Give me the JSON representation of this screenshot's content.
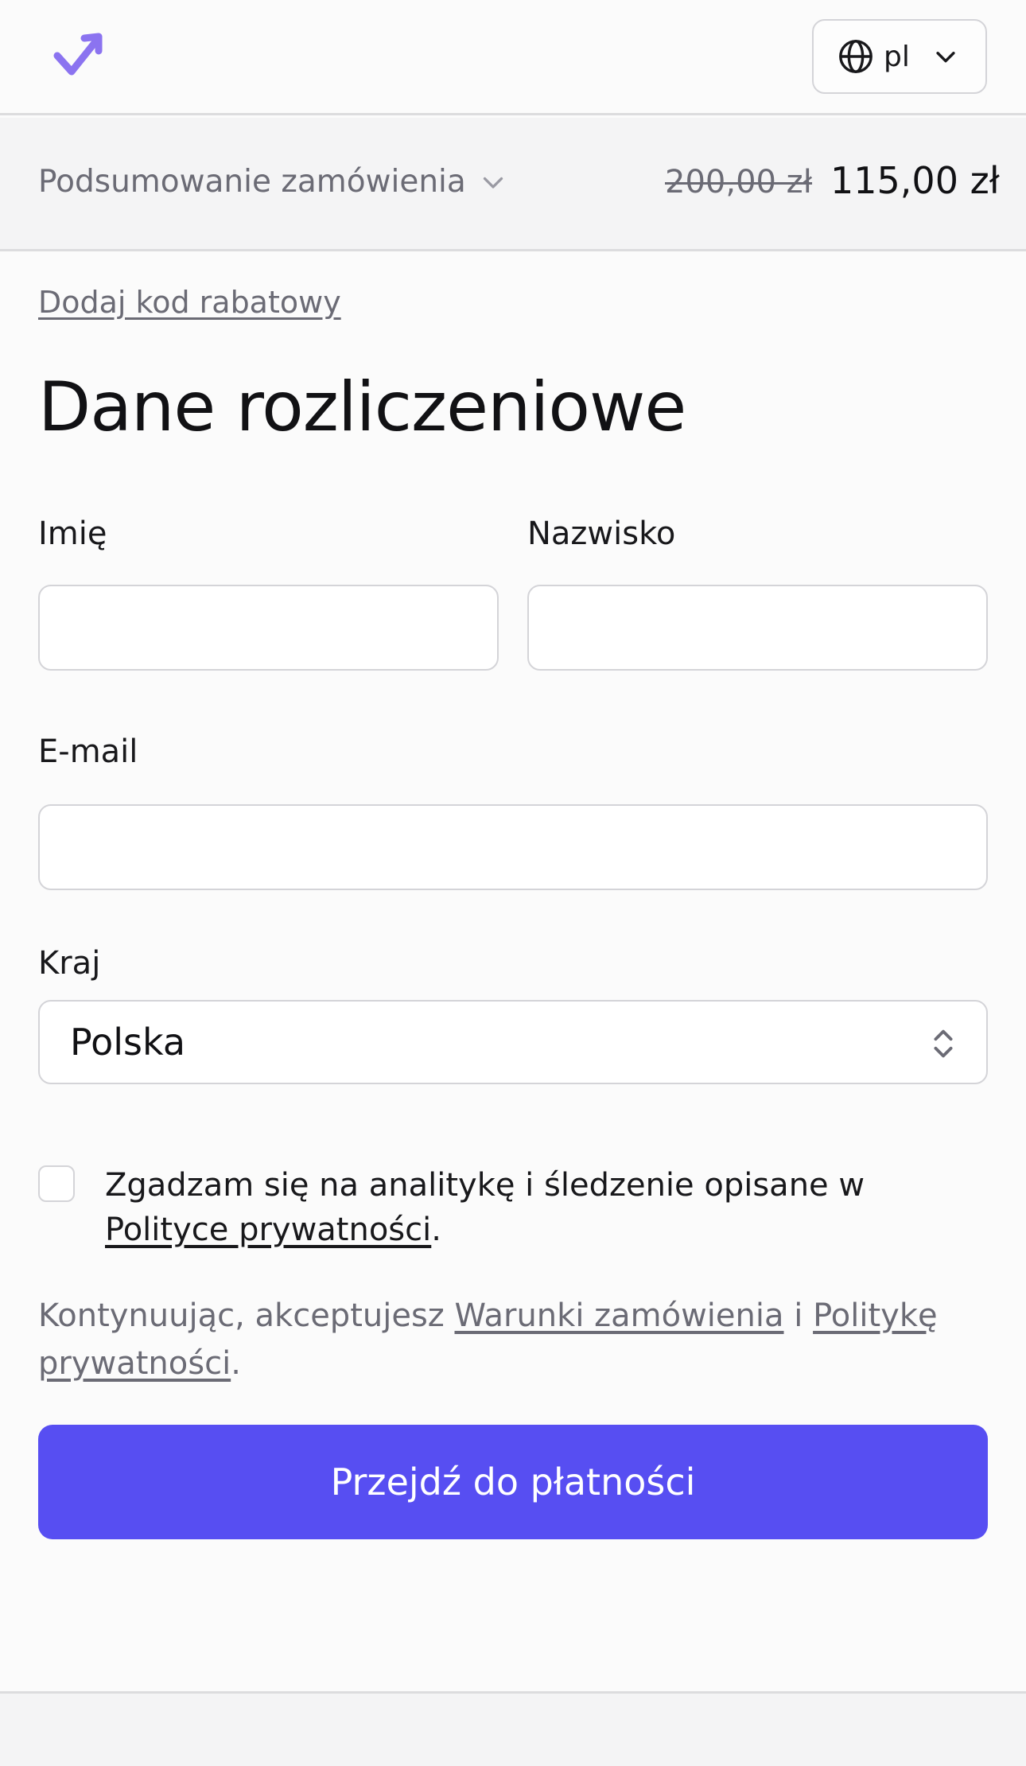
{
  "header": {
    "logo_icon": "checkmark-arrow-logo",
    "language": "pl",
    "globe_icon": "globe-icon",
    "chevron_icon": "chevron-down-icon"
  },
  "summary": {
    "label": "Podsumowanie zamówienia",
    "old_price": "200,00 zł",
    "new_price": "115,00 zł"
  },
  "discount_link": "Dodaj kod rabatowy",
  "form": {
    "title": "Dane rozliczeniowe",
    "first_name_label": "Imię",
    "last_name_label": "Nazwisko",
    "email_label": "E-mail",
    "first_name_value": "",
    "last_name_value": "",
    "email_value": "",
    "country_label": "Kraj",
    "country_value": "Polska"
  },
  "consent": {
    "text": "Zgadzam się na analitykę i śledzenie opisane w ",
    "link": "Polityce prywatności",
    "suffix": "."
  },
  "terms": {
    "prefix": "Kontynuując, akceptujesz ",
    "terms_link": "Warunki zamówienia",
    "conjunction": " i ",
    "privacy_link": "Politykę prywatności",
    "suffix": "."
  },
  "cta_label": "Przejdź do płatności",
  "colors": {
    "accent": "#574ef2",
    "logo": "#8b73f0",
    "muted_text": "#6b6b75",
    "border": "#d4d4d8"
  }
}
